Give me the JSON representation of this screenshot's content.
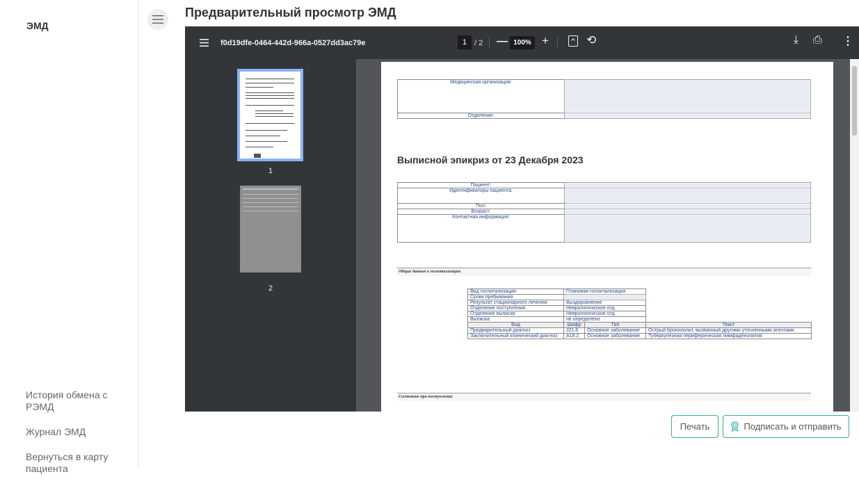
{
  "sidebar": {
    "brand": "ЭМД",
    "nav": [
      {
        "label": "История обмена с РЭМД"
      },
      {
        "label": "Журнал ЭМД"
      },
      {
        "label": "Вернуться в карту пациента"
      }
    ]
  },
  "page_title": "Предварительный просмотр ЭМД",
  "viewer": {
    "filename": "f0d19dfe-0464-442d-966a-0527dd3ac79e",
    "current_page": "1",
    "page_count": "/ 2",
    "zoom": "100%",
    "thumbnails": [
      "1",
      "2"
    ]
  },
  "document": {
    "org_label": "Медицинская организация:",
    "dept_label": "Отделение:",
    "heading": "Выписной эпикриз от 23 Декабря 2023",
    "patient_fields": [
      "Пациент:",
      "Идентификаторы пациента:",
      "Пол:",
      "Возраст:",
      "Контактная информация:"
    ],
    "section_general": "Общие данные о госпитализации",
    "hosp_rows": [
      {
        "k": "Вид госпитализации",
        "v": "Плановая госпитализация"
      },
      {
        "k": "Сроки пребывания",
        "v": ""
      },
      {
        "k": "Результат стационарного лечения",
        "v": "Выздоровление"
      },
      {
        "k": "Отделение поступления",
        "v": "Неврологическое отд."
      },
      {
        "k": "Отделение выписки",
        "v": "Неврологическое отд."
      },
      {
        "k": "Выписка",
        "v": "не определено"
      }
    ],
    "diag_headers": [
      "Вид",
      "Шифр",
      "Тип",
      "Текст"
    ],
    "diag_rows": [
      {
        "kind": "Предварительный диагноз",
        "code": "J21.8",
        "type": "Основное заболевание",
        "text": "Острый бронхиолит, вызванный другими уточненными агентами"
      },
      {
        "kind": "Заключительный клинический диагноз",
        "code": "A18.2",
        "type": "Основное заболевание",
        "text": "Туберкулезная периферическая лимфаденопатия"
      }
    ],
    "section_admission": "Состояние при поступлении"
  },
  "actions": {
    "print": "Печать",
    "sign_send": "Подписать и отправить"
  },
  "colors": {
    "accent": "#36a8a8",
    "viewer_toolbar": "#323639",
    "viewer_bg": "#525659",
    "thumb_active": "#8ab4f8"
  }
}
